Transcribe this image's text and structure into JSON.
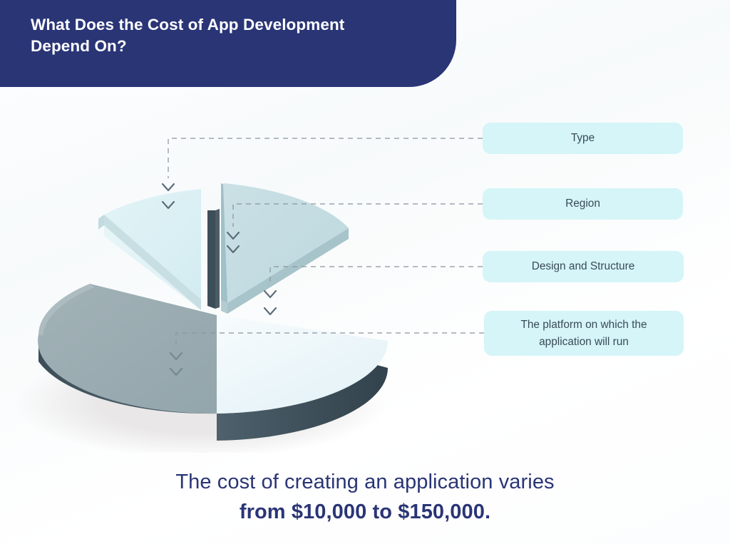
{
  "header": {
    "title": "What Does the Cost of App Development\nDepend On?",
    "background_color": "#2a3576",
    "text_color": "#ffffff"
  },
  "labels": [
    {
      "id": "type",
      "text": "Type"
    },
    {
      "id": "region",
      "text": "Region"
    },
    {
      "id": "design-and-structure",
      "text": "Design and Structure"
    },
    {
      "id": "platform",
      "text": "The platform on which the application will run"
    }
  ],
  "caption": {
    "line1": "The cost of creating an application varies",
    "line2": "from $10,000 to $150,000.",
    "color": "#2a3576"
  },
  "palette": {
    "navy": "#2a3576",
    "label_bg": "#d5f5f8",
    "label_text": "#3a4a55",
    "connector": "#8b97a0",
    "chevron": "#5a6b78",
    "slice_large_top": "#9aacb1",
    "slice_large_side": "#44555f",
    "slice_pale_top": "#eef7fa",
    "slice_pale_side": "#3d4e59",
    "slice_mid_top": "#c3dce1",
    "slice_mid_side": "#a8c4cb",
    "slice_cyan_top": "#dbf0f4",
    "slice_cyan_side": "#b9d4da",
    "shadow": "#eceaea"
  },
  "chart_data": {
    "type": "pie",
    "title": "What Does the Cost of App Development Depend On?",
    "render_style": "3d-exploded-donut",
    "legend_position": "right",
    "categories": [
      "The platform on which the application will run",
      "Region",
      "Design and Structure",
      "Type"
    ],
    "values": [
      45,
      20,
      20,
      15
    ],
    "unit": "percent",
    "labels_shown": false,
    "slices": [
      {
        "label": "The platform on which the application will run",
        "value": 45,
        "top_color": "#9aacb1",
        "side_color": "#44555f",
        "exploded": false
      },
      {
        "label": "Region",
        "value": 20,
        "top_color": "#eef7fa",
        "side_color": "#3d4e59",
        "exploded": false
      },
      {
        "label": "Design and Structure",
        "value": 20,
        "top_color": "#c3dce1",
        "side_color": "#a8c4cb",
        "exploded": true
      },
      {
        "label": "Type",
        "value": 15,
        "top_color": "#dbf0f4",
        "side_color": "#b9d4da",
        "exploded": true
      }
    ]
  }
}
